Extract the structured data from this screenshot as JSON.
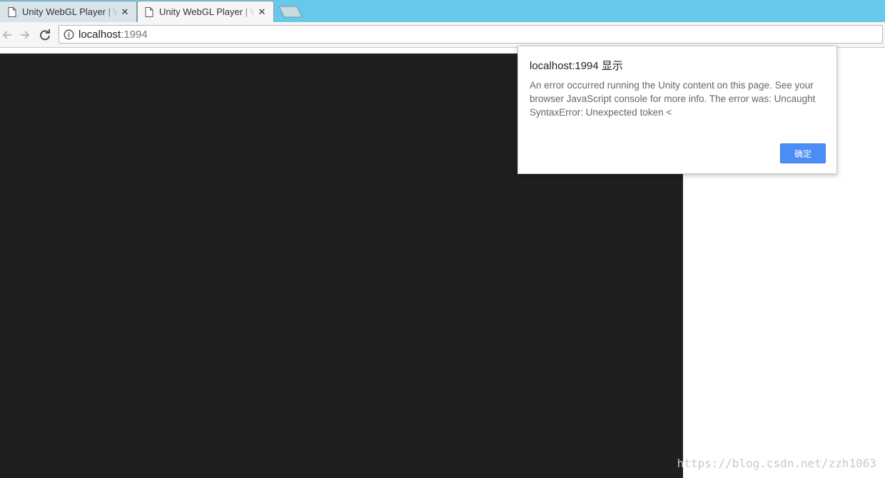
{
  "tabs": [
    {
      "title": "Unity WebGL Player | Web",
      "close": "✕"
    },
    {
      "title": "Unity WebGL Player | Web",
      "close": "✕"
    }
  ],
  "addressbar": {
    "host": "localhost",
    "port": ":1994"
  },
  "dialog": {
    "title": "localhost:1994 显示",
    "message": "An error occurred running the Unity content on this page. See your browser JavaScript console for more info. The error was: Uncaught SyntaxError: Unexpected token <",
    "ok_label": "确定"
  },
  "watermark": "https://blog.csdn.net/zzh1063",
  "colors": {
    "tabstrip": "#66c9ec",
    "canvas": "#211e1f",
    "dialog_button": "#4c8ef7"
  },
  "icons": {
    "tab": "document-icon",
    "back": "arrow-left-icon",
    "forward": "arrow-right-icon",
    "reload": "reload-icon",
    "site_info": "info-icon"
  }
}
